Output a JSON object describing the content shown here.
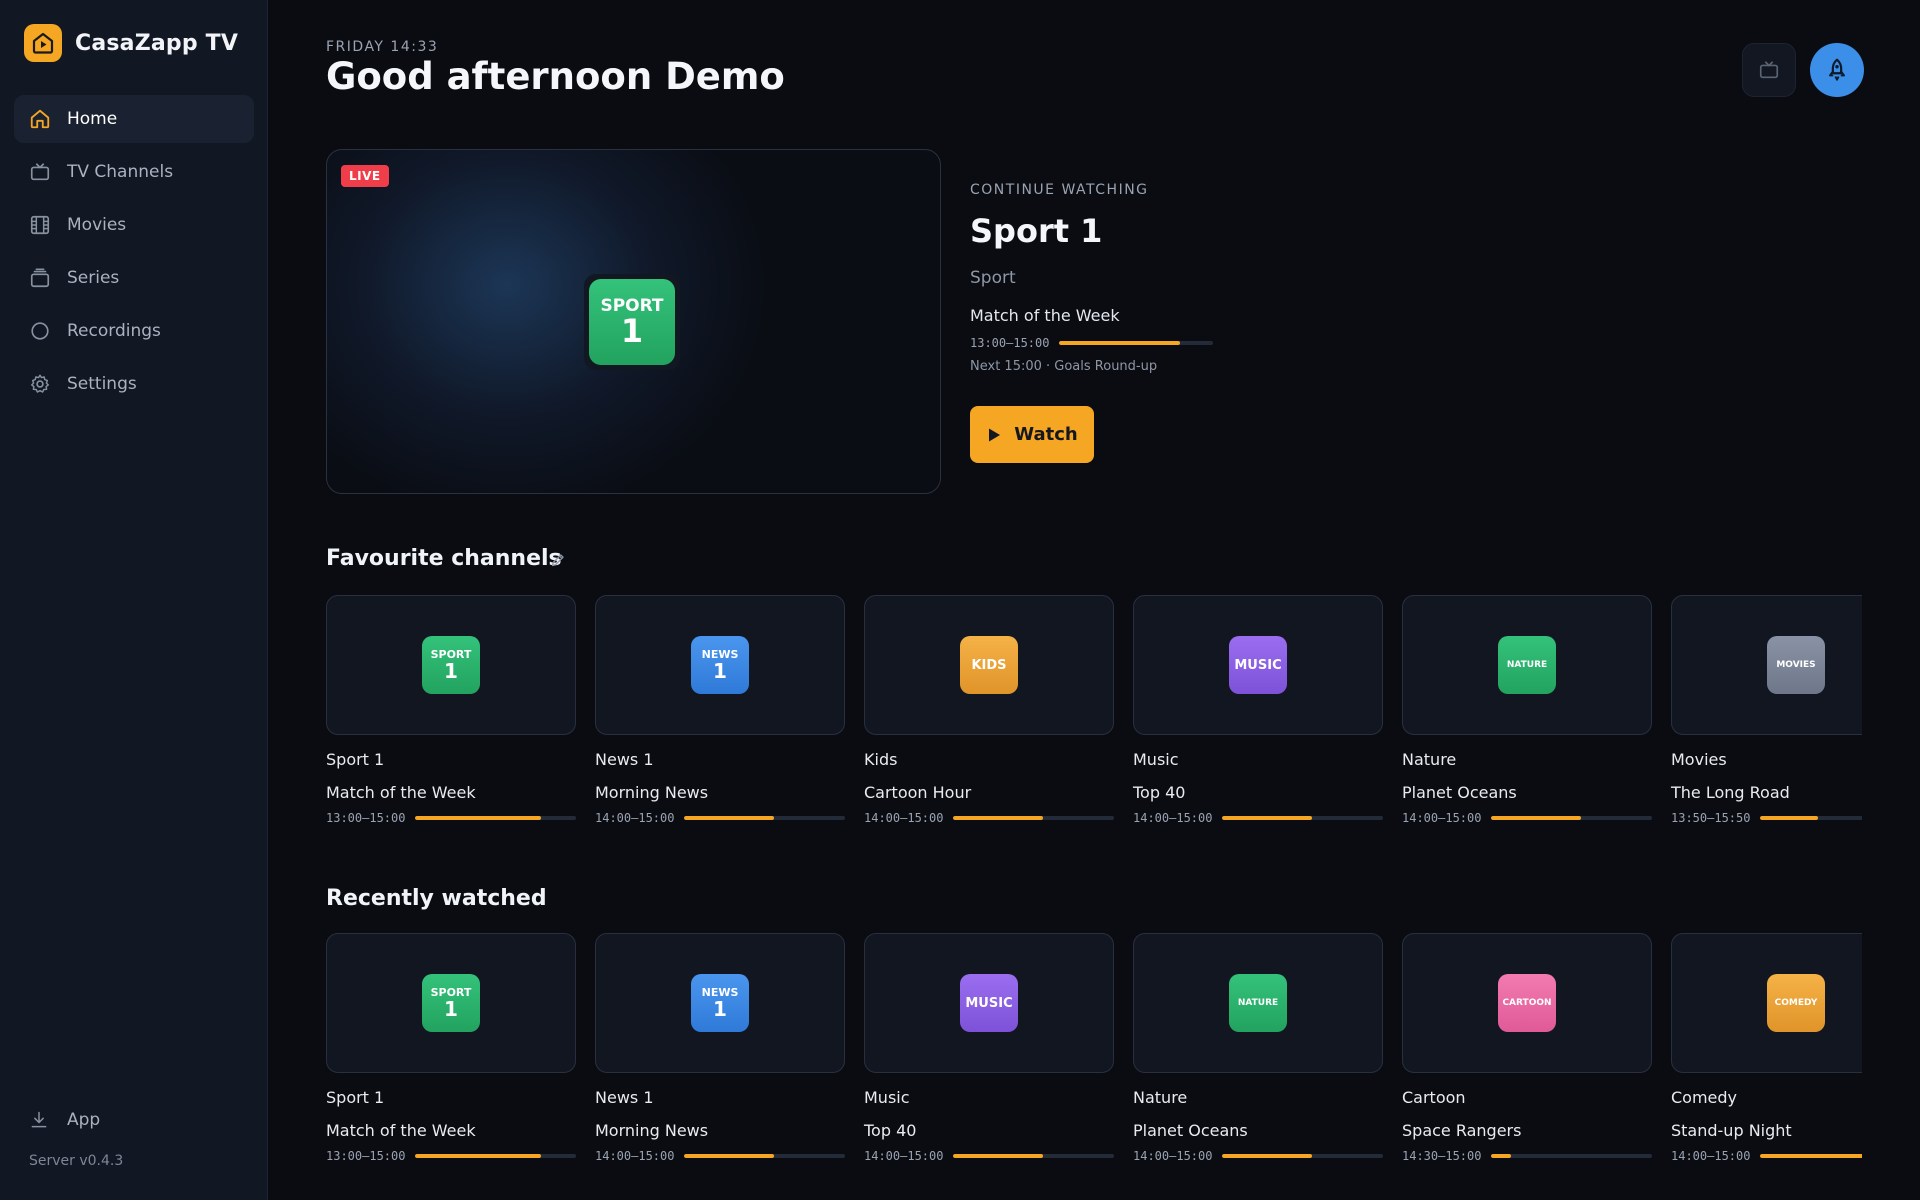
{
  "brand": {
    "name": "CasaZapp TV",
    "accent": "#f5a623"
  },
  "nav": [
    {
      "label": "Home",
      "icon": "home-icon",
      "active": true
    },
    {
      "label": "TV Channels",
      "icon": "tv-icon",
      "active": false
    },
    {
      "label": "Movies",
      "icon": "film-icon",
      "active": false
    },
    {
      "label": "Series",
      "icon": "series-icon",
      "active": false
    },
    {
      "label": "Recordings",
      "icon": "record-icon",
      "active": false
    },
    {
      "label": "Settings",
      "icon": "gear-icon",
      "active": false
    }
  ],
  "footer": {
    "app_label": "App",
    "server": "Server v0.4.3"
  },
  "header": {
    "daytime": "FRIDAY 14:33",
    "greeting": "Good afternoon Demo"
  },
  "hero": {
    "live": "LIVE",
    "logo_top": "SPORT",
    "logo_bottom": "1",
    "label": "CONTINUE WATCHING",
    "title": "Sport 1",
    "genre": "Sport",
    "program": "Match of the Week",
    "time": "13:00–15:00",
    "progress": 0.78,
    "next": "Next 15:00 · Goals Round-up",
    "watch": "Watch"
  },
  "favourites": {
    "title": "Favourite channels",
    "cards": [
      {
        "name": "Sport 1",
        "program": "Match of the Week",
        "time": "13:00–15:00",
        "progress": 0.78,
        "logo_top": "SPORT",
        "logo_bottom": "1",
        "color_a": "#34c27a",
        "color_b": "#22a35f"
      },
      {
        "name": "News 1",
        "program": "Morning News",
        "time": "14:00–15:00",
        "progress": 0.56,
        "logo_top": "NEWS",
        "logo_bottom": "1",
        "color_a": "#4a96ee",
        "color_b": "#2f7ad8"
      },
      {
        "name": "Kids",
        "program": "Cartoon Hour",
        "time": "14:00–15:00",
        "progress": 0.56,
        "logo_top": "KIDS",
        "logo_bottom": "",
        "color_a": "#f5b246",
        "color_b": "#e0942a"
      },
      {
        "name": "Music",
        "program": "Top 40",
        "time": "14:00–15:00",
        "progress": 0.56,
        "logo_top": "MUSIC",
        "logo_bottom": "",
        "color_a": "#9b6ef0",
        "color_b": "#7d52d8"
      },
      {
        "name": "Nature",
        "program": "Planet Oceans",
        "time": "14:00–15:00",
        "progress": 0.56,
        "logo_top": "NATURE",
        "logo_bottom": "",
        "color_a": "#34c27a",
        "color_b": "#22a35f"
      },
      {
        "name": "Movies",
        "program": "The Long Road",
        "time": "13:50–15:50",
        "progress": 0.36,
        "logo_top": "MOVIES",
        "logo_bottom": "",
        "color_a": "#8a93a5",
        "color_b": "#6e7789"
      }
    ]
  },
  "recent": {
    "title": "Recently watched",
    "cards": [
      {
        "name": "Sport 1",
        "program": "Match of the Week",
        "time": "13:00–15:00",
        "progress": 0.78,
        "logo_top": "SPORT",
        "logo_bottom": "1",
        "color_a": "#34c27a",
        "color_b": "#22a35f"
      },
      {
        "name": "News 1",
        "program": "Morning News",
        "time": "14:00–15:00",
        "progress": 0.56,
        "logo_top": "NEWS",
        "logo_bottom": "1",
        "color_a": "#4a96ee",
        "color_b": "#2f7ad8"
      },
      {
        "name": "Music",
        "program": "Top 40",
        "time": "14:00–15:00",
        "progress": 0.56,
        "logo_top": "MUSIC",
        "logo_bottom": "",
        "color_a": "#9b6ef0",
        "color_b": "#7d52d8"
      },
      {
        "name": "Nature",
        "program": "Planet Oceans",
        "time": "14:00–15:00",
        "progress": 0.56,
        "logo_top": "NATURE",
        "logo_bottom": "",
        "color_a": "#34c27a",
        "color_b": "#22a35f"
      },
      {
        "name": "Cartoon",
        "program": "Space Rangers",
        "time": "14:30–15:00",
        "progress": 0.12,
        "logo_top": "CARTOON",
        "logo_bottom": "",
        "color_a": "#f27bb0",
        "color_b": "#e05a98"
      },
      {
        "name": "Comedy",
        "program": "Stand-up Night",
        "time": "14:00–15:00",
        "progress": 0.9,
        "logo_top": "COMEDY",
        "logo_bottom": "",
        "color_a": "#f5b246",
        "color_b": "#e0942a"
      }
    ]
  }
}
